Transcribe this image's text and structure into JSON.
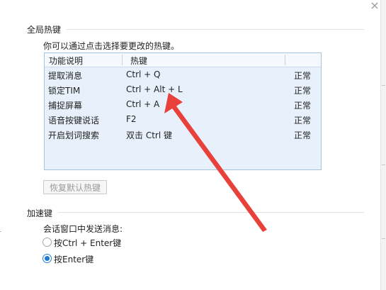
{
  "window": {
    "close_glyph": "×"
  },
  "global_hotkeys": {
    "title": "全局热键",
    "hint": "你可以通过点击选择要更改的热键。",
    "columns": [
      "功能说明",
      "热键"
    ],
    "rows": [
      {
        "function": "提取消息",
        "hotkey": "Ctrl + Q",
        "status": "正常"
      },
      {
        "function": "锁定TIM",
        "hotkey": "Ctrl + Alt + L",
        "status": "正常"
      },
      {
        "function": "捕捉屏幕",
        "hotkey": "Ctrl + A",
        "status": "正常"
      },
      {
        "function": "语音按键说话",
        "hotkey": "F2",
        "status": "正常"
      },
      {
        "function": "开启划词搜索",
        "hotkey": "双击 Ctrl 键",
        "status": "正常"
      }
    ],
    "restore_label": "恢复默认热键"
  },
  "accelerator": {
    "title": "加速键",
    "send_label": "会话窗口中发送消息:",
    "options": [
      {
        "label": "按Ctrl + Enter键",
        "checked": false
      },
      {
        "label": "按Enter键",
        "checked": true
      }
    ]
  },
  "colors": {
    "annotation_arrow": "#e8403a",
    "radio_accent": "#1f78d1",
    "table_bg": "#e8f1fb"
  }
}
